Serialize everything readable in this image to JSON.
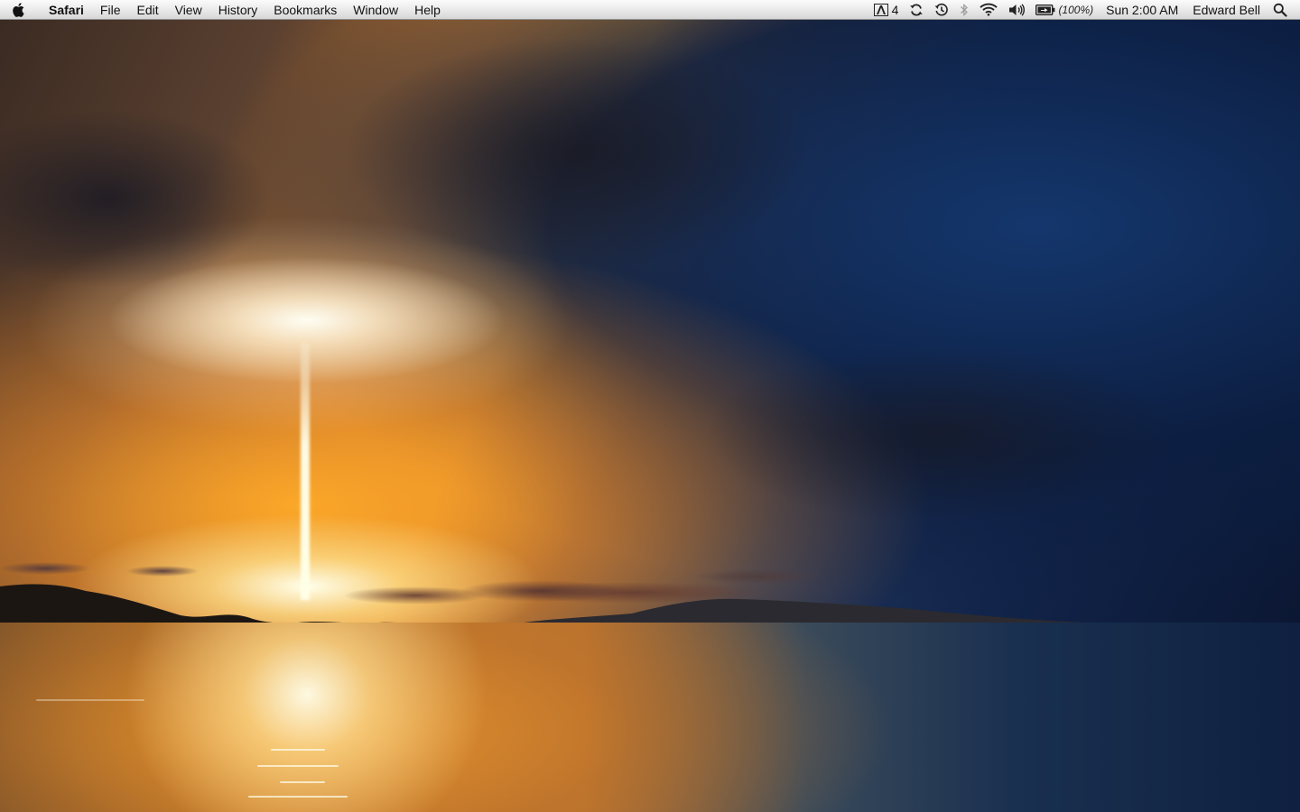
{
  "menubar": {
    "apple_icon": "apple-logo-icon",
    "app_name": "Safari",
    "menus": [
      "File",
      "Edit",
      "View",
      "History",
      "Bookmarks",
      "Window",
      "Help"
    ],
    "status": {
      "adobe_updates_icon": "adobe-updater-icon",
      "adobe_updates_count": "4",
      "sync_icon": "sync-icon",
      "time_machine_icon": "time-machine-icon",
      "bluetooth_icon": "bluetooth-icon",
      "wifi_icon": "wifi-icon",
      "volume_icon": "volume-icon",
      "battery_icon": "battery-charging-icon",
      "battery_percent": "(100%)",
      "clock": "Sun 2:00 AM",
      "user": "Edward Bell",
      "spotlight_icon": "spotlight-search-icon"
    }
  },
  "desktop": {
    "wallpaper": "sunset-over-water",
    "colors": {
      "sky_gold": "#d8922e",
      "storm_blue": "#12244a",
      "menubar_bg": "#e9e9e9"
    }
  }
}
